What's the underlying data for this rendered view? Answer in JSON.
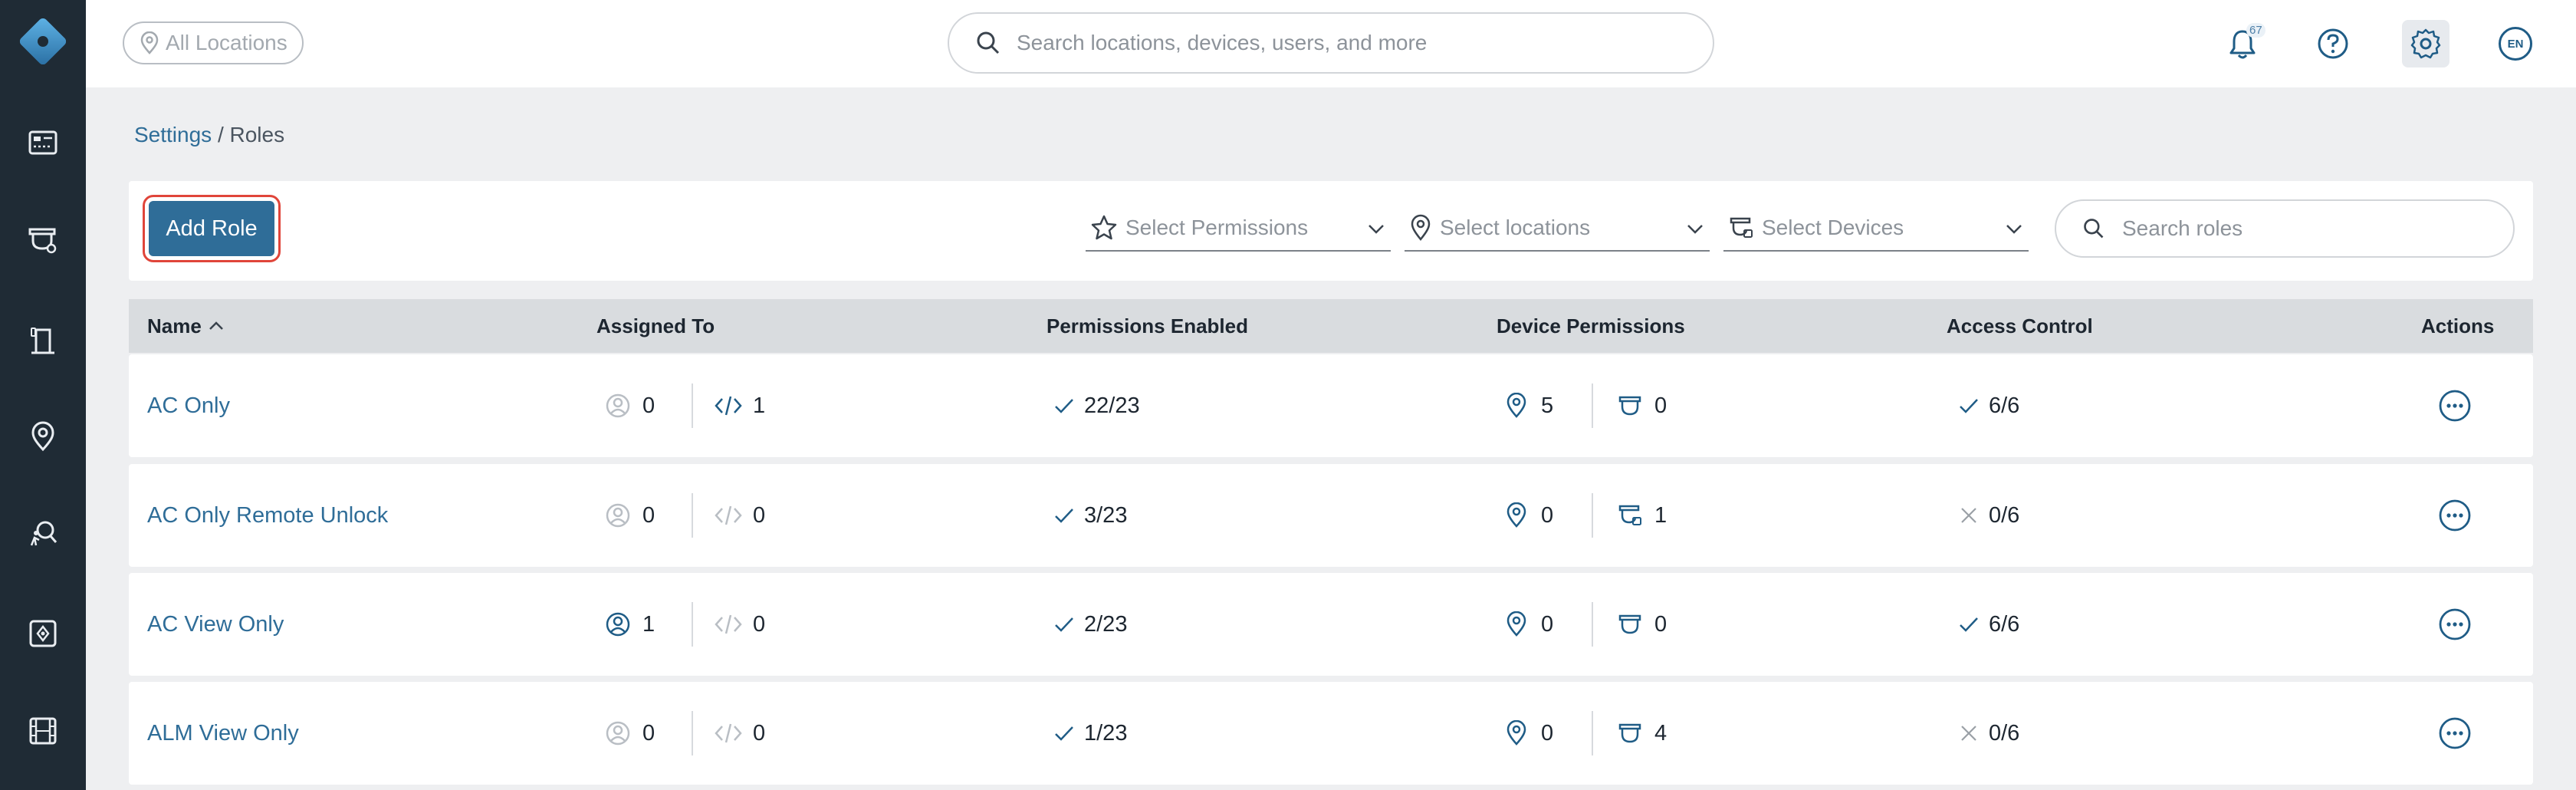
{
  "header": {
    "location_pill": "All Locations",
    "search_placeholder": "Search locations, devices, users, and more",
    "notification_count": "67",
    "language": "EN"
  },
  "sidebar": {
    "items": [
      "dashboard-icon",
      "camera-icon",
      "door-access-icon",
      "location-pin-icon",
      "person-search-icon",
      "integrations-icon",
      "video-film-icon"
    ]
  },
  "breadcrumb": {
    "parent": "Settings",
    "separator": " / ",
    "current": "Roles"
  },
  "toolbar": {
    "add_role": "Add Role",
    "permissions_placeholder": "Select Permissions",
    "locations_placeholder": "Select locations",
    "devices_placeholder": "Select Devices",
    "search_placeholder": "Search roles"
  },
  "table": {
    "columns": {
      "name": "Name",
      "assigned_to": "Assigned To",
      "permissions_enabled": "Permissions Enabled",
      "device_permissions": "Device Permissions",
      "access_control": "Access Control",
      "actions": "Actions"
    },
    "rows": [
      {
        "name": "AC Only",
        "users": "0",
        "users_active": false,
        "api": "1",
        "api_active": true,
        "permissions": "22/23",
        "locations": "5",
        "devices": "0",
        "device_icon": "camera-dome-icon",
        "access": "6/6",
        "access_enabled": true
      },
      {
        "name": "AC Only Remote Unlock",
        "users": "0",
        "users_active": false,
        "api": "0",
        "api_active": false,
        "permissions": "3/23",
        "locations": "0",
        "devices": "1",
        "device_icon": "camera-lock-icon",
        "access": "0/6",
        "access_enabled": false
      },
      {
        "name": "AC View Only",
        "users": "1",
        "users_active": true,
        "api": "0",
        "api_active": false,
        "permissions": "2/23",
        "locations": "0",
        "devices": "0",
        "device_icon": "camera-dome-icon",
        "access": "6/6",
        "access_enabled": true
      },
      {
        "name": "ALM View Only",
        "users": "0",
        "users_active": false,
        "api": "0",
        "api_active": false,
        "permissions": "1/23",
        "locations": "0",
        "devices": "4",
        "device_icon": "camera-dome-icon",
        "access": "0/6",
        "access_enabled": false
      }
    ]
  },
  "colors": {
    "sidebar": "#1f2b35",
    "accent": "#2f6d98",
    "highlight_border": "#e0453a"
  }
}
